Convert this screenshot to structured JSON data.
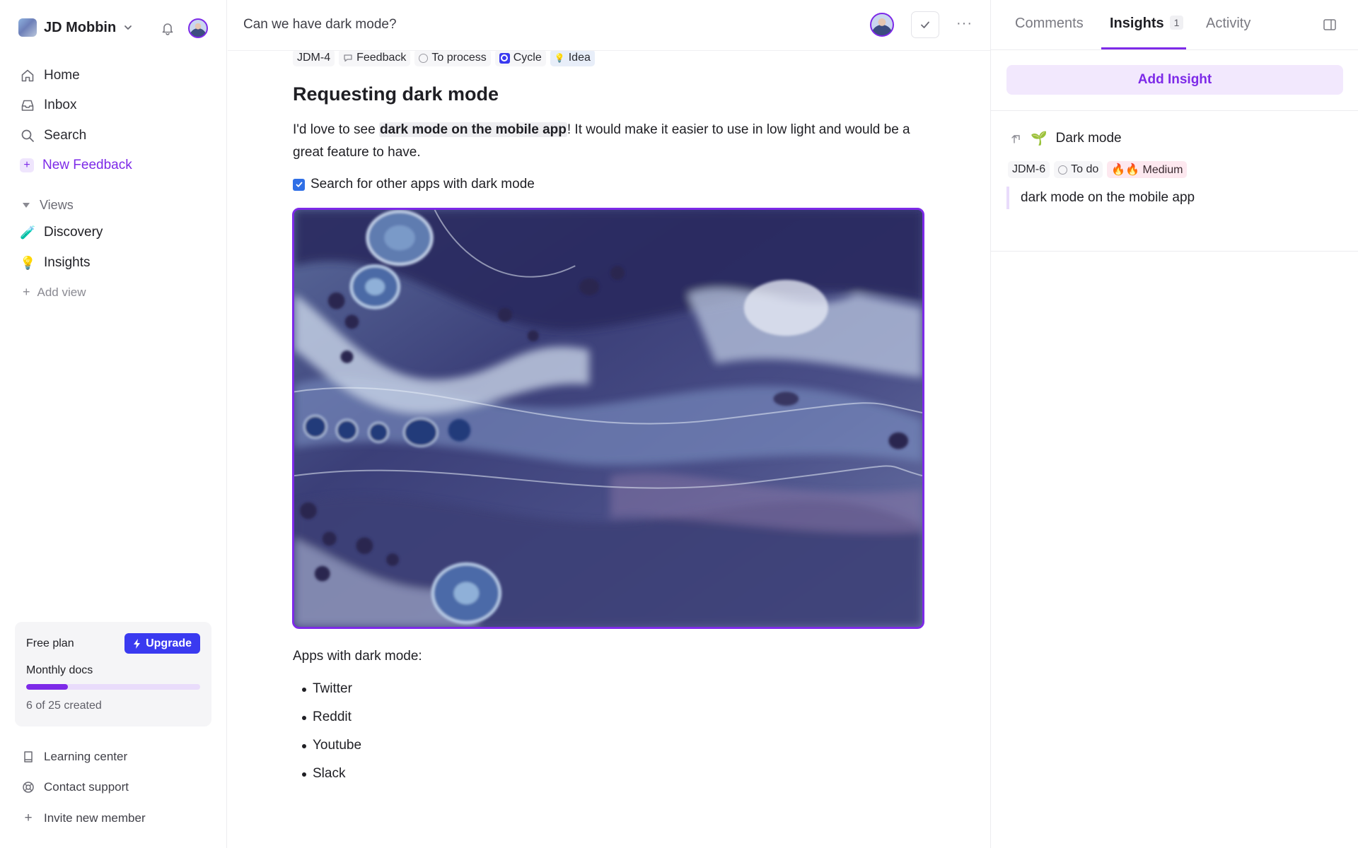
{
  "workspace": {
    "name": "JD Mobbin"
  },
  "nav": [
    {
      "label": "Home"
    },
    {
      "label": "Inbox"
    },
    {
      "label": "Search"
    },
    {
      "label": "New Feedback"
    }
  ],
  "views": {
    "header": "Views",
    "items": [
      {
        "label": "Discovery",
        "icon": "🧪"
      },
      {
        "label": "Insights",
        "icon": "💡"
      }
    ],
    "add_label": "Add view"
  },
  "plan": {
    "name": "Free plan",
    "upgrade_label": "Upgrade",
    "docs_label": "Monthly docs",
    "used": 6,
    "total": 25,
    "count_text": "6 of 25 created"
  },
  "footer": [
    {
      "label": "Learning center"
    },
    {
      "label": "Contact support"
    },
    {
      "label": "Invite new member"
    }
  ],
  "doc": {
    "title": "Can we have dark mode?",
    "tags": {
      "id": "JDM-4",
      "type": "Feedback",
      "status": "To process",
      "cycle": "Cycle",
      "idea": "Idea"
    },
    "heading": "Requesting dark mode",
    "para_before": "I'd love to see ",
    "para_highlight": "dark mode on the mobile app",
    "para_after": "! It would make it easier to use in low light and would be a great feature to have.",
    "todo": "Search for other apps with dark mode",
    "list_heading": "Apps with dark mode:",
    "apps": [
      "Twitter",
      "Reddit",
      "Youtube",
      "Slack"
    ]
  },
  "panel": {
    "tabs": [
      {
        "label": "Comments"
      },
      {
        "label": "Insights",
        "count": "1"
      },
      {
        "label": "Activity"
      }
    ],
    "add_insight_label": "Add Insight",
    "insight": {
      "icon": "🌱",
      "title": "Dark mode",
      "id": "JDM-6",
      "status": "To do",
      "priority": "🔥🔥 Medium",
      "quote": "dark mode on the mobile app"
    }
  },
  "colors": {
    "accent": "#7d2ae8",
    "upgrade": "#3a3af0",
    "checkbox": "#2f6fe6"
  }
}
